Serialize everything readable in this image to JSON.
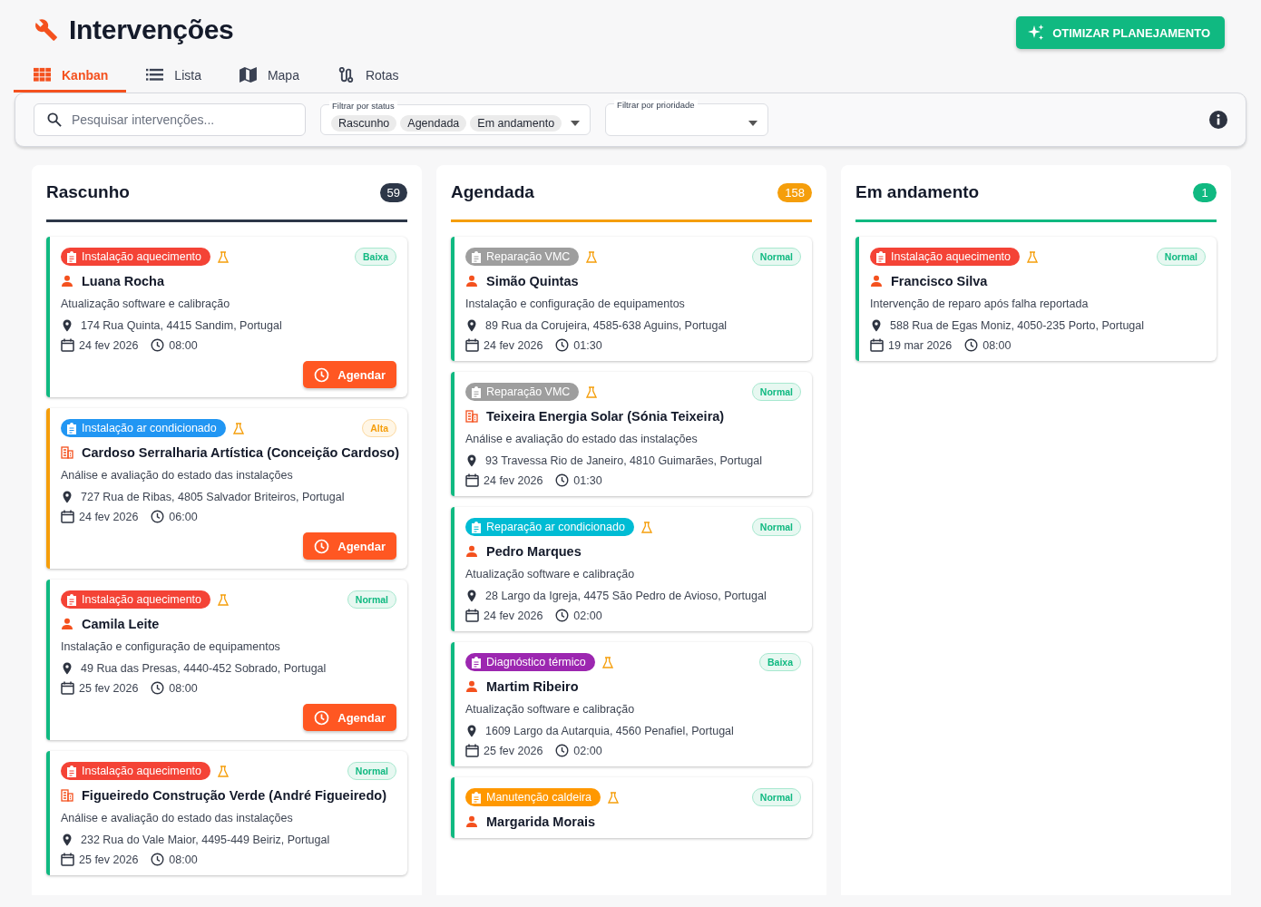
{
  "title": "Intervenções",
  "optimize_button": "OTIMIZAR PLANEJAMENTO",
  "tabs": [
    {
      "label": "Kanban",
      "selected": true
    },
    {
      "label": "Lista",
      "selected": false
    },
    {
      "label": "Mapa",
      "selected": false
    },
    {
      "label": "Rotas",
      "selected": false
    }
  ],
  "filters": {
    "search": {
      "placeholder": "Pesquisar intervenções..."
    },
    "status": {
      "label": "Filtrar por status",
      "chips": [
        "Rascunho",
        "Agendada",
        "Em andamento"
      ]
    },
    "priority": {
      "label": "Filtrar por prioridade"
    }
  },
  "columns": [
    {
      "title": "Rascunho",
      "count": "59",
      "color": "#2d3748",
      "cards": [
        {
          "type": {
            "label": "Instalação aquecimento",
            "color": "#f44336"
          },
          "priority": {
            "label": "Baixa",
            "kind": "low"
          },
          "client": {
            "kind": "person",
            "name": "Luana Rocha"
          },
          "description": "Atualização software e calibração",
          "address": "174 Rua Quinta, 4415 Sandim, Portugal",
          "date": "24 fev 2026",
          "time": "08:00",
          "action": "Agendar"
        },
        {
          "type": {
            "label": "Instalação ar condicionado",
            "color": "#2196f3"
          },
          "priority": {
            "label": "Alta",
            "kind": "high"
          },
          "client": {
            "kind": "company",
            "name": "Cardoso Serralharia Artística (Conceição Cardoso)"
          },
          "description": "Análise e avaliação do estado das instalações",
          "address": "727 Rua de Ribas, 4805 Salvador Briteiros, Portugal",
          "date": "24 fev 2026",
          "time": "06:00",
          "action": "Agendar"
        },
        {
          "type": {
            "label": "Instalação aquecimento",
            "color": "#f44336"
          },
          "priority": {
            "label": "Normal",
            "kind": "normal"
          },
          "client": {
            "kind": "person",
            "name": "Camila Leite"
          },
          "description": "Instalação e configuração de equipamentos",
          "address": "49 Rua das Presas, 4440-452 Sobrado, Portugal",
          "date": "25 fev 2026",
          "time": "08:00",
          "action": "Agendar"
        },
        {
          "type": {
            "label": "Instalação aquecimento",
            "color": "#f44336"
          },
          "priority": {
            "label": "Normal",
            "kind": "normal"
          },
          "client": {
            "kind": "company",
            "name": "Figueiredo Construção Verde (André Figueiredo)"
          },
          "description": "Análise e avaliação do estado das instalações",
          "address": "232 Rua do Vale Maior, 4495-449 Beiriz, Portugal",
          "date": "25 fev 2026",
          "time": "08:00"
        }
      ]
    },
    {
      "title": "Agendada",
      "count": "158",
      "color": "#f59e0b",
      "cards": [
        {
          "type": {
            "label": "Reparação VMC",
            "color": "#9e9e9e"
          },
          "priority": {
            "label": "Normal",
            "kind": "normal"
          },
          "client": {
            "kind": "person",
            "name": "Simão Quintas"
          },
          "description": "Instalação e configuração de equipamentos",
          "address": "89 Rua da Corujeira, 4585-638 Aguins, Portugal",
          "date": "24 fev 2026",
          "time": "01:30"
        },
        {
          "type": {
            "label": "Reparação VMC",
            "color": "#9e9e9e"
          },
          "priority": {
            "label": "Normal",
            "kind": "normal"
          },
          "client": {
            "kind": "company",
            "name": "Teixeira Energia Solar (Sónia Teixeira)"
          },
          "description": "Análise e avaliação do estado das instalações",
          "address": "93 Travessa Rio de Janeiro, 4810 Guimarães, Portugal",
          "date": "24 fev 2026",
          "time": "01:30"
        },
        {
          "type": {
            "label": "Reparação ar condicionado",
            "color": "#00bcd4"
          },
          "priority": {
            "label": "Normal",
            "kind": "normal"
          },
          "client": {
            "kind": "person",
            "name": "Pedro Marques"
          },
          "description": "Atualização software e calibração",
          "address": "28 Largo da Igreja, 4475 São Pedro de Avioso, Portugal",
          "date": "24 fev 2026",
          "time": "02:00"
        },
        {
          "type": {
            "label": "Diagnóstico térmico",
            "color": "#9c27b0"
          },
          "priority": {
            "label": "Baixa",
            "kind": "low"
          },
          "client": {
            "kind": "person",
            "name": "Martim Ribeiro"
          },
          "description": "Atualização software e calibração",
          "address": "1609 Largo da Autarquia, 4560 Penafiel, Portugal",
          "date": "25 fev 2026",
          "time": "02:00"
        },
        {
          "type": {
            "label": "Manutenção caldeira",
            "color": "#ff9800"
          },
          "priority": {
            "label": "Normal",
            "kind": "normal"
          },
          "client": {
            "kind": "person",
            "name": "Margarida Morais"
          }
        }
      ]
    },
    {
      "title": "Em andamento",
      "count": "1",
      "color": "#10b981",
      "cards": [
        {
          "type": {
            "label": "Instalação aquecimento",
            "color": "#f44336"
          },
          "priority": {
            "label": "Normal",
            "kind": "normal"
          },
          "client": {
            "kind": "person",
            "name": "Francisco Silva"
          },
          "description": "Intervenção de reparo após falha reportada",
          "address": "588 Rua de Egas Moniz, 4050-235 Porto, Portugal",
          "date": "19 mar 2026",
          "time": "08:00"
        }
      ]
    }
  ]
}
